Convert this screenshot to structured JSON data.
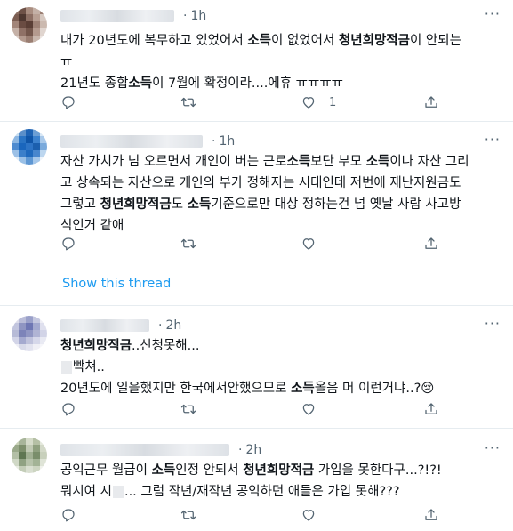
{
  "tweets": [
    {
      "time": "1h",
      "lines": [
        [
          {
            "t": "내가 20년도에 복무하고 있었어서 "
          },
          {
            "t": "소득",
            "b": true
          },
          {
            "t": "이 없었어서 "
          },
          {
            "t": "청년희망적금",
            "b": true
          },
          {
            "t": "이 안되는"
          }
        ],
        [
          {
            "t": "ㅠ"
          }
        ],
        [
          {
            "t": "21년도 종합"
          },
          {
            "t": "소득",
            "b": true
          },
          {
            "t": "이 7월에 확정이라....에휴 ㅠㅠㅠㅠ"
          }
        ]
      ],
      "like_count": "1"
    },
    {
      "time": "1h",
      "lines": [
        [
          {
            "t": "자산 가치가 넘 오르면서 개인이 버는 근로"
          },
          {
            "t": "소득",
            "b": true
          },
          {
            "t": "보단 부모 "
          },
          {
            "t": "소득",
            "b": true
          },
          {
            "t": "이나 자산 그리"
          }
        ],
        [
          {
            "t": "고 상속되는 자산으로 개인의 부가 정해지는 시대인데 저번에 재난지원금도"
          }
        ],
        [
          {
            "t": "그렇고 "
          },
          {
            "t": "청년희망적금",
            "b": true
          },
          {
            "t": "도 "
          },
          {
            "t": "소득",
            "b": true
          },
          {
            "t": "기준으로만 대상 정하는건 넘 옛날 사람 사고방"
          }
        ],
        [
          {
            "t": "식인거 같애"
          }
        ]
      ],
      "like_count": "",
      "show_thread": "Show this thread"
    },
    {
      "time": "2h",
      "lines": [
        [
          {
            "t": "청년희망적금",
            "b": true
          },
          {
            "t": "..신청못해..."
          }
        ],
        [
          {
            "m": true
          },
          {
            "t": "빡쳐.."
          }
        ],
        [
          {
            "t": "20년도에 일을했지만 한국에서안했으므로 "
          },
          {
            "t": "소득",
            "b": true
          },
          {
            "t": "올음 머 이런거냐..?😢"
          }
        ]
      ],
      "like_count": ""
    },
    {
      "time": "2h",
      "lines": [
        [
          {
            "t": "공익근무 월급이 "
          },
          {
            "t": "소득",
            "b": true
          },
          {
            "t": "인정 안되서 "
          },
          {
            "t": "청년희망적금",
            "b": true
          },
          {
            "t": " 가입을 못한다구...?!?!"
          }
        ],
        [
          {
            "t": "뭐시여 시"
          },
          {
            "m": true
          },
          {
            "t": "... 그럼 작년/재작년 공익하던 애들은 가입 못해???"
          }
        ]
      ],
      "like_count": ""
    }
  ],
  "icons": {
    "reply": "reply-icon",
    "retweet": "retweet-icon",
    "like": "heart-icon",
    "share": "share-icon",
    "more": "more-icon"
  },
  "colors": {
    "accent": "#1d9bf0",
    "text": "#0f1419",
    "muted": "#536471",
    "divider": "#e6ecf0"
  }
}
